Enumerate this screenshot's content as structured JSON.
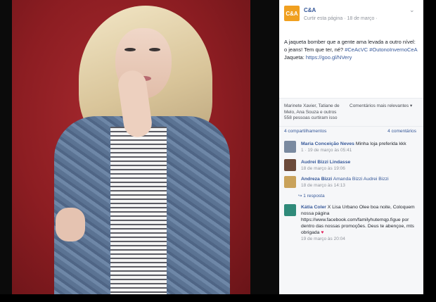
{
  "post": {
    "page_name": "C&A",
    "page_initials": "C&A",
    "subline": "Curtir esta página · 18 de março ·",
    "caption_text": "A jaqueta bomber que a gente ama levada a outro nível: o jeans! Tem que ter, né?",
    "caption_tags": "#CeAcVC #OutonoInvernoCeA",
    "caption_link_label": "Jaqueta:",
    "caption_link": "https://goo.gl/NVery"
  },
  "reactions": {
    "likes_text": "Marinete Xavier, Tatiane de Melo, Ana Souza e outros",
    "likes_count": "558 pessoas curtiram isso",
    "sort_label": "Comentários mais relevantes ▾"
  },
  "counts": {
    "shares": "4 compartilhamentos",
    "comments": "4 comentários"
  },
  "comments": [
    {
      "name": "Maria Conceição Neves",
      "text": "Minha loja preferida kkk",
      "meta": "1 · 19 de março às 05:41"
    },
    {
      "name": "Audrei Bizzi Lindasse",
      "text": "",
      "meta": "18 de março às 19:06"
    },
    {
      "name": "Andreza Bizzi",
      "text": "Amanda Bizzi Audrei Bizzi",
      "meta": "18 de março às 14:13"
    },
    {
      "name": "Kátia Coler",
      "text": "X Lisa Urbano Olee boa noite, Coloquem nossa página https://www.facebook.com/familyhutemqp.figue por dentro das nossas promoções. Deus te abençoe, mts obrigada",
      "meta": "19 de março às 20:04"
    }
  ],
  "reply_label": "↪ 1 resposta",
  "colors": {
    "accent": "#365899",
    "brand": "#f0a020",
    "heart": "#e0245e"
  },
  "icons": {
    "chevron": "chevron-down-icon",
    "heart": "heart-icon",
    "reply": "reply-icon"
  }
}
